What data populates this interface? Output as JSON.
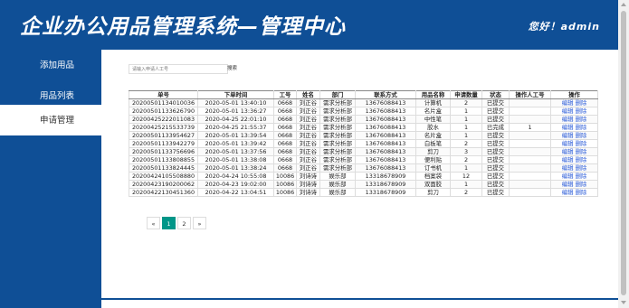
{
  "header": {
    "title": "企业办公用品管理系统—管理中心",
    "greeting": "您好！admin"
  },
  "sidebar": {
    "items": [
      {
        "label": "添加用品"
      },
      {
        "label": "用品列表"
      },
      {
        "label": "申请管理"
      }
    ]
  },
  "search": {
    "placeholder": "请输入申请人工号",
    "button_label": "搜索"
  },
  "table": {
    "headers": [
      "单号",
      "下单时间",
      "工号",
      "姓名",
      "部门",
      "联系方式",
      "用品名称",
      "申请数量",
      "状态",
      "操作人工号",
      "操作"
    ],
    "edit_label": "编辑",
    "delete_label": "删除",
    "rows": [
      [
        "20200501134010036",
        "2020-05-01 13:40:10",
        "0668",
        "刘正谷",
        "需求分析部",
        "13676088413",
        "计算机",
        "2",
        "已提交",
        ""
      ],
      [
        "20200501133626790",
        "2020-05-01 13:36:27",
        "0668",
        "刘正谷",
        "需求分析部",
        "13676088413",
        "名片盒",
        "1",
        "已提交",
        ""
      ],
      [
        "20200425222011083",
        "2020-04-25 22:01:10",
        "0668",
        "刘正谷",
        "需求分析部",
        "13676088413",
        "中性笔",
        "1",
        "已提交",
        ""
      ],
      [
        "20200425215533739",
        "2020-04-25 21:55:37",
        "0668",
        "刘正谷",
        "需求分析部",
        "13676088413",
        "胶水",
        "1",
        "已完成",
        "1"
      ],
      [
        "20200501133954627",
        "2020-05-01 13:39:54",
        "0668",
        "刘正谷",
        "需求分析部",
        "13676088413",
        "名片盒",
        "1",
        "已提交",
        ""
      ],
      [
        "20200501133942279",
        "2020-05-01 13:39:42",
        "0668",
        "刘正谷",
        "需求分析部",
        "13676088413",
        "白板笔",
        "2",
        "已提交",
        ""
      ],
      [
        "20200501133756696",
        "2020-05-01 13:37:56",
        "0668",
        "刘正谷",
        "需求分析部",
        "13676088413",
        "剪刀",
        "3",
        "已提交",
        ""
      ],
      [
        "20200501133808855",
        "2020-05-01 13:38:08",
        "0668",
        "刘正谷",
        "需求分析部",
        "13676088413",
        "便利贴",
        "2",
        "已提交",
        ""
      ],
      [
        "20200501133824445",
        "2020-05-01 13:38:24",
        "0668",
        "刘正谷",
        "需求分析部",
        "13676088413",
        "订书机",
        "1",
        "已提交",
        ""
      ],
      [
        "20200424105508880",
        "2020-04-24 10:55:08",
        "10086",
        "刘诗诗",
        "娱乐部",
        "13318678909",
        "档案袋",
        "12",
        "已提交",
        ""
      ],
      [
        "20200423190200062",
        "2020-04-23 19:02:00",
        "10086",
        "刘诗诗",
        "娱乐部",
        "13318678909",
        "双面胶",
        "1",
        "已提交",
        ""
      ],
      [
        "20200422130451360",
        "2020-04-22 13:04:51",
        "10086",
        "刘诗诗",
        "娱乐部",
        "13318678909",
        "剪刀",
        "2",
        "已提交",
        ""
      ]
    ]
  },
  "pagination": {
    "prev": "«",
    "pages": [
      "1",
      "2"
    ],
    "current": "1",
    "next": "»"
  },
  "colors": {
    "primary": "#0f4f96",
    "page_active": "#009688",
    "link": "#2a5bd8"
  }
}
